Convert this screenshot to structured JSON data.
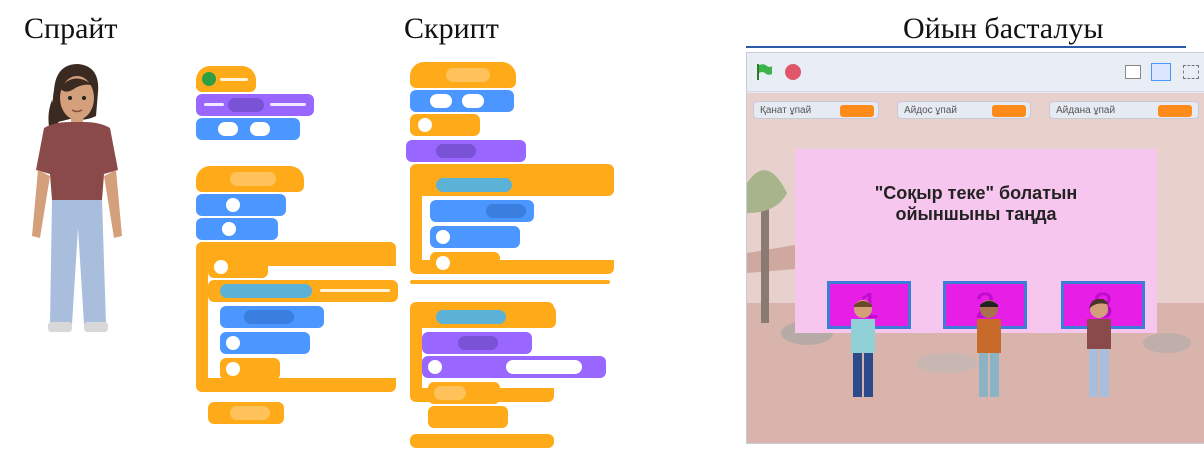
{
  "captions": {
    "sprite": "Спрайт",
    "script": "Скрипт",
    "game_start": "Ойын басталуы"
  },
  "stage": {
    "variables": [
      {
        "label": "Қанат ұпай",
        "value": ""
      },
      {
        "label": "Айдос ұпай",
        "value": ""
      },
      {
        "label": "Айдана ұпай",
        "value": ""
      }
    ],
    "dialog": {
      "title": "\"Соқыр теке\" болатын\nойыншыны таңда",
      "choices": [
        "1",
        "2",
        "3"
      ]
    }
  },
  "colors": {
    "events": "#ffab19",
    "looks": "#9966ff",
    "motion": "#4c97ff",
    "sensing": "#5cb1d6",
    "dialog_bg": "#f7c6ee",
    "choice_bg": "#e61ee6",
    "green_flag": "#2ea043",
    "stop": "#e0566b"
  },
  "icons": [
    "green-flag-icon",
    "stop-icon",
    "small-stage-icon",
    "normal-stage-icon",
    "fullscreen-icon"
  ]
}
